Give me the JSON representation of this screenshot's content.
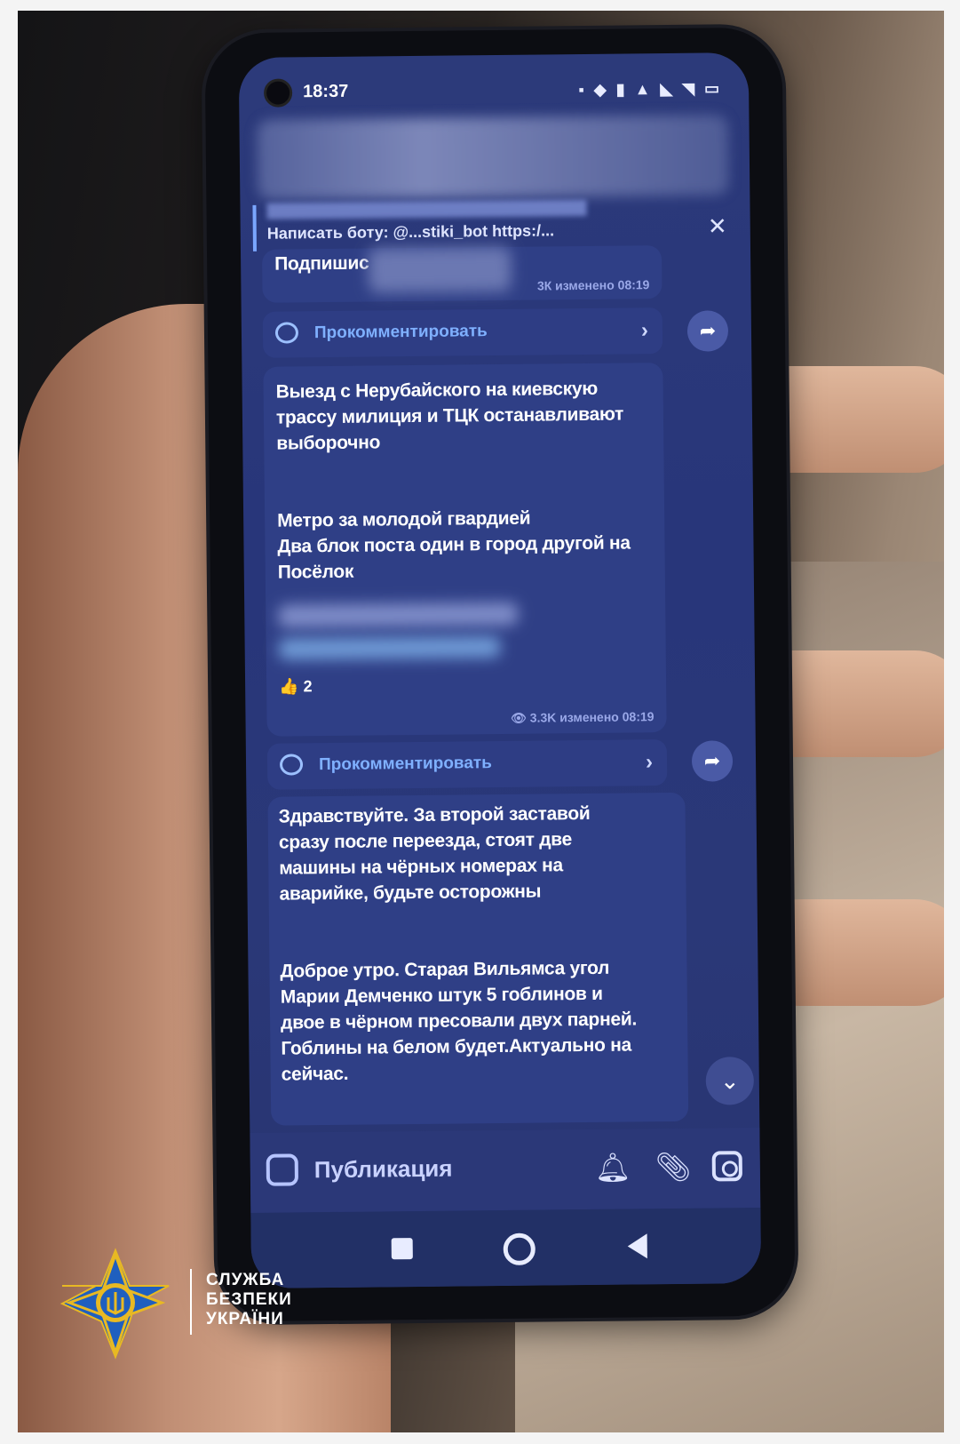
{
  "status_bar": {
    "time": "18:37"
  },
  "pinned": {
    "text": "Написать боту: @...stiki_bot  https:/...",
    "close_glyph": "✕"
  },
  "posts": [
    {
      "text_lines": [
        "Подпишис"
      ],
      "meta": "3К  изменено 08:19",
      "comment_label": "Прокомментировать"
    },
    {
      "text_lines": [
        "Выезд с Нерубайского на киевскую",
        "трассу милиция и ТЦК останавливают",
        "выборочно",
        "",
        "",
        "Метро за молодой гвардией",
        "Два блок поста один в город другой на",
        "Посёлок"
      ],
      "reaction": "👍 2",
      "meta": "👁 3.3K  изменено 08:19",
      "comment_label": "Прокомментировать"
    },
    {
      "text_lines": [
        "Здравствуйте. За второй заставой",
        "сразу после переезда, стоят две",
        "машины на чёрных номерах на",
        "аварийке, будьте осторожны",
        "",
        "",
        "Доброе утро. Старая Вильямса угол",
        "Марии Демченко штук 5 гоблинов и",
        "двое в чёрном пресовали двух парней.",
        "Гоблины на белом будет.Актуально на",
        "сейчас."
      ]
    }
  ],
  "input": {
    "placeholder": "Публикация"
  },
  "watermark": {
    "line1": "СЛУЖБА",
    "line2": "БЕЗПЕКИ",
    "line3": "УКРАЇНИ"
  },
  "colors": {
    "screen_bg": "#2c3a7a",
    "bubble": "#2f3f86",
    "link": "#7fb0ff",
    "sbu_blue": "#1f5fbf",
    "sbu_gold": "#e8b923"
  }
}
